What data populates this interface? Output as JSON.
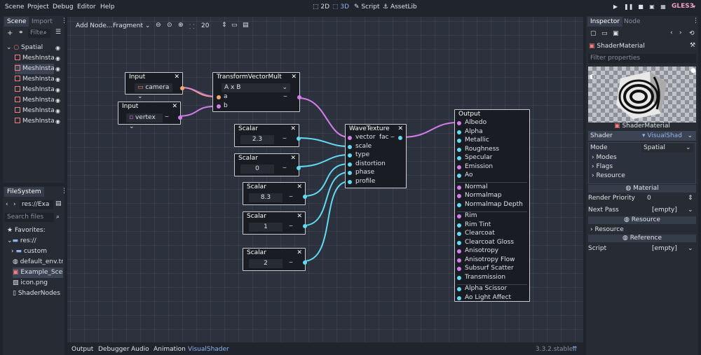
{
  "menubar": {
    "scene": "Scene",
    "project": "Project",
    "debug": "Debug",
    "editor": "Editor",
    "help": "Help",
    "ws_2d": "2D",
    "ws_3d": "3D",
    "ws_script": "Script",
    "ws_assetlib": "AssetLib",
    "renderer": "GLES3"
  },
  "scene_dock": {
    "tab_scene": "Scene",
    "tab_import": "Import",
    "filter_placeholder": "Filte",
    "root": "Spatial",
    "children": [
      "MeshInsta",
      "MeshInsta",
      "MeshInsta",
      "MeshInsta",
      "MeshInsta",
      "MeshInsta",
      "MeshInsta"
    ]
  },
  "fs_dock": {
    "title": "FileSystem",
    "path": "res://Exa",
    "search_placeholder": "Search files",
    "favorites": "Favorites:",
    "root": "res://",
    "items": [
      "custom",
      "default_env.tr",
      "Example_Scen",
      "icon.png",
      "ShaderNodes"
    ]
  },
  "graph_toolbar": {
    "add_node": "Add Node...",
    "fragment": "Fragment",
    "zoom": "20"
  },
  "nodes": {
    "input1": {
      "title": "Input",
      "value": "camera"
    },
    "input2": {
      "title": "Input",
      "value": "vertex"
    },
    "transform": {
      "title": "TransformVectorMult",
      "op": "A x B",
      "port_a": "a",
      "port_b": "b"
    },
    "scalar1": {
      "title": "Scalar",
      "value": "2.3"
    },
    "scalar2": {
      "title": "Scalar",
      "value": "0"
    },
    "scalar3": {
      "title": "Scalar",
      "value": "8.3"
    },
    "scalar4": {
      "title": "Scalar",
      "value": "1"
    },
    "scalar5": {
      "title": "Scalar",
      "value": "2"
    },
    "wave": {
      "title": "WaveTexture",
      "inputs": [
        "vector",
        "scale",
        "type",
        "distortion",
        "phase",
        "profile"
      ],
      "output": "fac"
    },
    "output": {
      "title": "Output",
      "ports": [
        "Albedo",
        "Alpha",
        "Metallic",
        "Roughness",
        "Specular",
        "Emission",
        "Ao",
        "Normal",
        "Normalmap",
        "Normalmap Depth",
        "Rim",
        "Rim Tint",
        "Clearcoat",
        "Clearcoat Gloss",
        "Anisotropy",
        "Anisotropy Flow",
        "Subsurf Scatter",
        "Transmission",
        "Alpha Scissor",
        "Ao Light Affect"
      ]
    }
  },
  "bottom_tabs": {
    "output": "Output",
    "debugger": "Debugger",
    "audio": "Audio",
    "animation": "Animation",
    "visualshader": "VisualShader",
    "version": "3.3.2.stable"
  },
  "inspector": {
    "tab_inspector": "Inspector",
    "tab_node": "Node",
    "resource": "ShaderMaterial",
    "filter_placeholder": "Filter properties",
    "preview_label": "ShaderMaterial",
    "shader_label": "Shader",
    "shader_value": "VisualShad",
    "mode_label": "Mode",
    "mode_value": "Spatial",
    "modes": "Modes",
    "flags": "Flags",
    "resource_sub": "Resource",
    "material_section": "Material",
    "render_priority_label": "Render Priority",
    "render_priority_value": "0",
    "next_pass_label": "Next Pass",
    "next_pass_value": "[empty]",
    "resource_section": "Resource",
    "resource_row": "Resource",
    "reference_section": "Reference",
    "script_label": "Script",
    "script_value": "[empty]"
  },
  "colors": {
    "vector_port": "#d67dee",
    "scalar_port": "#61daf4",
    "transform_port": "#f6a86e",
    "accent": "#8eb4f0"
  }
}
